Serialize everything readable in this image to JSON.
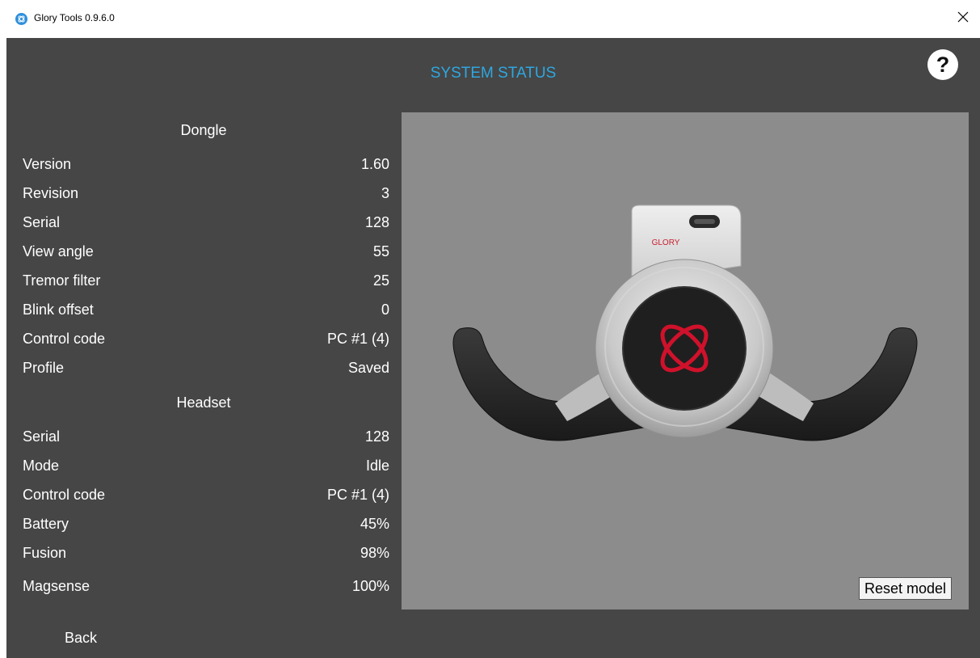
{
  "window": {
    "title": "Glory Tools 0.9.6.0",
    "close_glyph": "✕"
  },
  "page": {
    "title": "SYSTEM STATUS",
    "help_label": "?",
    "back_label": "Back"
  },
  "dongle": {
    "heading": "Dongle",
    "rows": [
      {
        "label": "Version",
        "value": "1.60"
      },
      {
        "label": "Revision",
        "value": "3"
      },
      {
        "label": "Serial",
        "value": "128"
      },
      {
        "label": "View angle",
        "value": "55"
      },
      {
        "label": "Tremor filter",
        "value": "25"
      },
      {
        "label": "Blink offset",
        "value": "0"
      },
      {
        "label": "Control code",
        "value": "PC #1 (4)"
      },
      {
        "label": "Profile",
        "value": "Saved"
      }
    ]
  },
  "headset": {
    "heading": "Headset",
    "rows": [
      {
        "label": "Serial",
        "value": "128"
      },
      {
        "label": "Mode",
        "value": "Idle"
      },
      {
        "label": "Control code",
        "value": "PC #1 (4)"
      },
      {
        "label": "Battery",
        "value": "45%"
      },
      {
        "label": "Fusion",
        "value": "98%"
      },
      {
        "label": "Magsense",
        "value": "100%"
      }
    ]
  },
  "model": {
    "brand_text": "GLORY",
    "reset_label": "Reset model"
  },
  "colors": {
    "accent": "#2ea7e0",
    "background": "#464646",
    "viewport": "#8c8c8c",
    "logo_red": "#d0112b"
  }
}
